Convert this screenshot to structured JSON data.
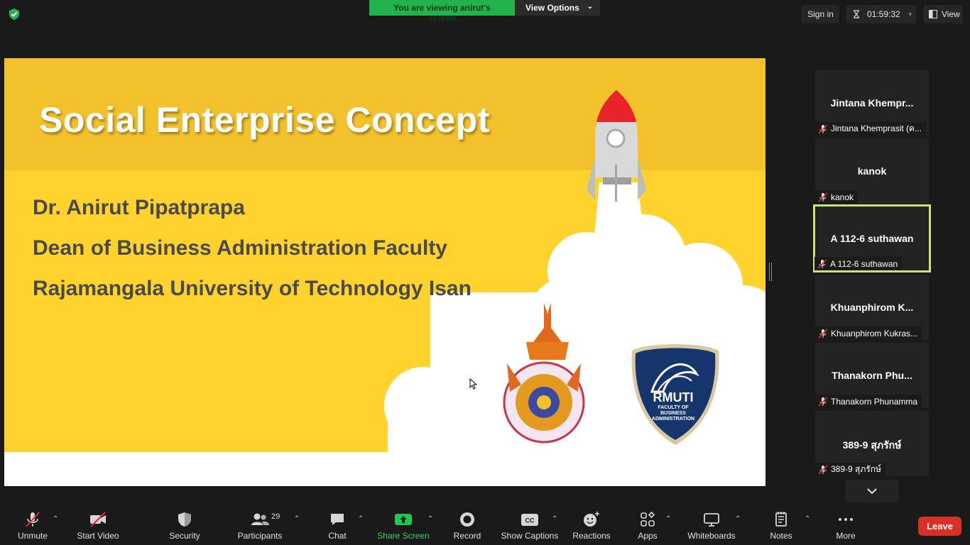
{
  "banner": {
    "viewing": "You are viewing anirut's screen",
    "view_options": "View Options"
  },
  "topbar": {
    "sign_in": "Sign in",
    "timer": "01:59:32",
    "view": "View"
  },
  "slide": {
    "title": "Social Enterprise Concept",
    "line1": "Dr. Anirut Pipatprapa",
    "line2": "Dean of Business Administration Faculty",
    "line3": "Rajamangala University of Technology Isan",
    "logo_big": "RMUTI",
    "logo_sub1": "FACULTY OF",
    "logo_sub2": "BUSINESS ADMINISTRATION"
  },
  "participants": [
    {
      "display": "Jintana  Khempr...",
      "label": "Jintana Khemprasit (ค...",
      "muted": true,
      "active": false
    },
    {
      "display": "kanok",
      "label": "kanok",
      "muted": true,
      "active": false
    },
    {
      "display": "A 112-6 suthawan",
      "label": "A 112-6 suthawan",
      "muted": true,
      "active": true
    },
    {
      "display": "Khuanphirom  K...",
      "label": "Khuanphirom Kukras...",
      "muted": true,
      "active": false
    },
    {
      "display": "Thanakorn  Phu...",
      "label": "Thanakorn Phunamma",
      "muted": true,
      "active": false
    },
    {
      "display": "389-9 สุภรักษ์",
      "label": "389-9 สุภรักษ์",
      "muted": true,
      "active": false
    }
  ],
  "toolbar": {
    "unmute": "Unmute",
    "start_video": "Start Video",
    "security": "Security",
    "participants": "Participants",
    "participants_count": "29",
    "chat": "Chat",
    "share_screen": "Share Screen",
    "record": "Record",
    "show_captions": "Show Captions",
    "reactions": "Reactions",
    "apps": "Apps",
    "whiteboards": "Whiteboards",
    "notes": "Notes",
    "more": "More",
    "leave": "Leave"
  },
  "colors": {
    "share_green": "#23b34c",
    "leave_red": "#d93025",
    "active_border": "#c9e27a",
    "slide_yellow": "#ffd22e"
  }
}
